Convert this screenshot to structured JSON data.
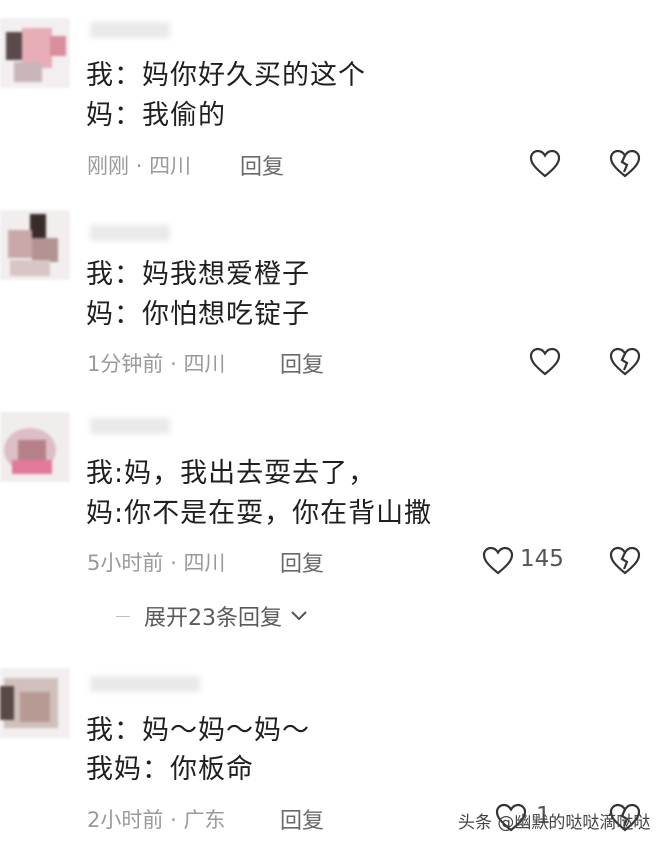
{
  "comments": [
    {
      "lines": [
        "我：妈你好久买的这个",
        "妈：我偷的"
      ],
      "time": "刚刚",
      "location": "四川",
      "reply_label": "回复",
      "likes": ""
    },
    {
      "lines": [
        "我：妈我想爱橙子",
        "妈：你怕想吃锭子"
      ],
      "time": "1分钟前",
      "location": "四川",
      "reply_label": "回复",
      "likes": ""
    },
    {
      "lines": [
        "我:妈，我出去耍去了，",
        "妈:你不是在耍，你在背山撒"
      ],
      "time": "5小时前",
      "location": "四川",
      "reply_label": "回复",
      "likes": "145"
    },
    {
      "lines": [
        "我：妈～妈～妈～",
        "我妈：你板命"
      ],
      "time": "2小时前",
      "location": "广东",
      "reply_label": "回复",
      "likes": "1"
    }
  ],
  "meta_separator": "·",
  "expand_replies": {
    "label": "展开23条回复"
  },
  "watermark": "头条 @幽默的哒哒滴哒哒",
  "icons": {
    "like": "heart-outline-icon",
    "dislike": "broken-heart-icon",
    "expand": "chevron-down-icon"
  },
  "colors": {
    "text": "#1f1f1f",
    "meta": "#9a9a9a",
    "icon": "#333333"
  }
}
